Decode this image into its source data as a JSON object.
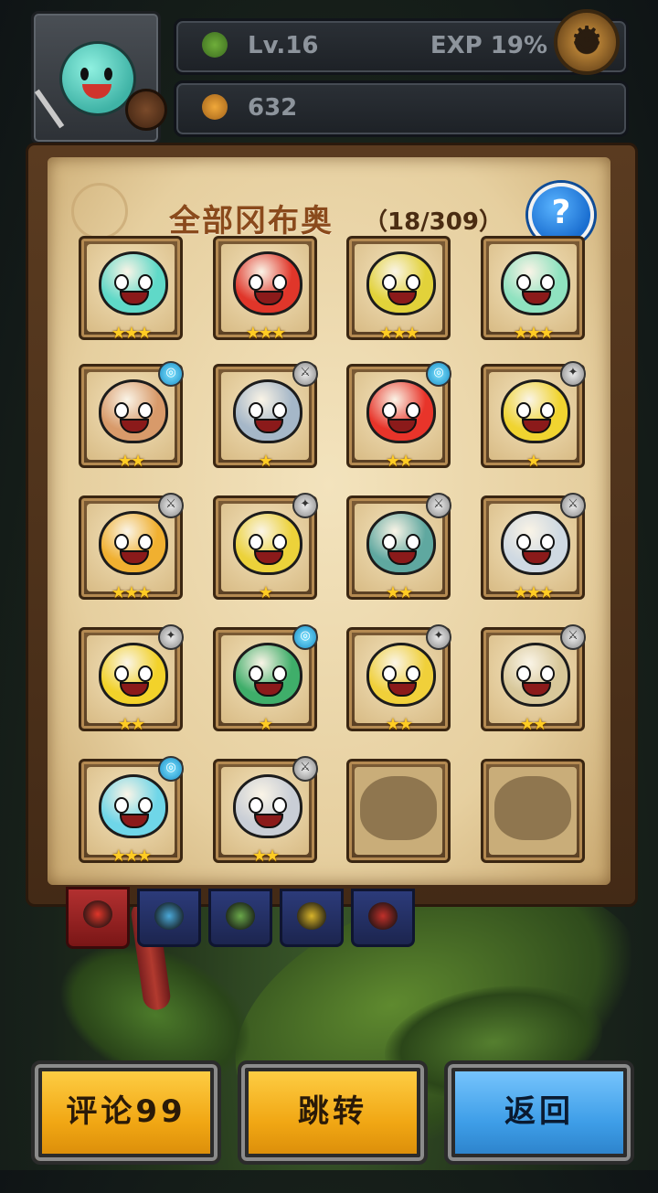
{
  "header": {
    "level": "Lv.16",
    "exp": "EXP  19%",
    "coins": "632",
    "icons": {
      "level": "clover-icon",
      "coins": "seed-pouch-icon",
      "settings": "gear-icon"
    }
  },
  "collection": {
    "title": "全部冈布奥",
    "count": "（18/309）",
    "help_label": "?",
    "cards": [
      {
        "stars": "★★★",
        "badge": "",
        "color": "#5fd9c8",
        "locked": false
      },
      {
        "stars": "★★★",
        "badge": "",
        "color": "#e0362a",
        "locked": false
      },
      {
        "stars": "★★★",
        "badge": "",
        "color": "#e2d23a",
        "locked": false
      },
      {
        "stars": "★★★",
        "badge": "",
        "color": "#8fe2c0",
        "locked": false
      },
      {
        "stars": "★★",
        "badge": "◎",
        "color": "#d89a6a",
        "locked": false
      },
      {
        "stars": "★",
        "badge": "⚔",
        "color": "#a5b7c8",
        "locked": false
      },
      {
        "stars": "★★",
        "badge": "◎",
        "color": "#e8342a",
        "locked": false
      },
      {
        "stars": "★",
        "badge": "✦",
        "color": "#f0d430",
        "locked": false
      },
      {
        "stars": "★★★",
        "badge": "⚔",
        "color": "#f0b030",
        "locked": false
      },
      {
        "stars": "★",
        "badge": "✦",
        "color": "#ecd23a",
        "locked": false
      },
      {
        "stars": "★★",
        "badge": "⚔",
        "color": "#5fa8a0",
        "locked": false
      },
      {
        "stars": "★★★",
        "badge": "⚔",
        "color": "#cfd9e2",
        "locked": false
      },
      {
        "stars": "★★",
        "badge": "✦",
        "color": "#f2d22a",
        "locked": false
      },
      {
        "stars": "★",
        "badge": "◎",
        "color": "#3fae6a",
        "locked": false
      },
      {
        "stars": "★★",
        "badge": "✦",
        "color": "#f0d03a",
        "locked": false
      },
      {
        "stars": "★★",
        "badge": "⚔",
        "color": "#d8c89a",
        "locked": false
      },
      {
        "stars": "★★★",
        "badge": "◎",
        "color": "#6fd6e8",
        "locked": false
      },
      {
        "stars": "★★",
        "badge": "⚔",
        "color": "#c9ced6",
        "locked": false
      },
      {
        "stars": "",
        "badge": "",
        "color": "",
        "locked": true
      },
      {
        "stars": "",
        "badge": "",
        "color": "",
        "locked": true
      }
    ]
  },
  "tabs": [
    {
      "name": "all",
      "color": "#e0362a",
      "active": true
    },
    {
      "name": "blue",
      "color": "#4aa8d8",
      "active": false
    },
    {
      "name": "green",
      "color": "#6aa84a",
      "active": false
    },
    {
      "name": "yellow",
      "color": "#d8b42a",
      "active": false
    },
    {
      "name": "red",
      "color": "#c0302a",
      "active": false
    }
  ],
  "buttons": {
    "comment": "评论99",
    "jump": "跳转",
    "back": "返回"
  }
}
